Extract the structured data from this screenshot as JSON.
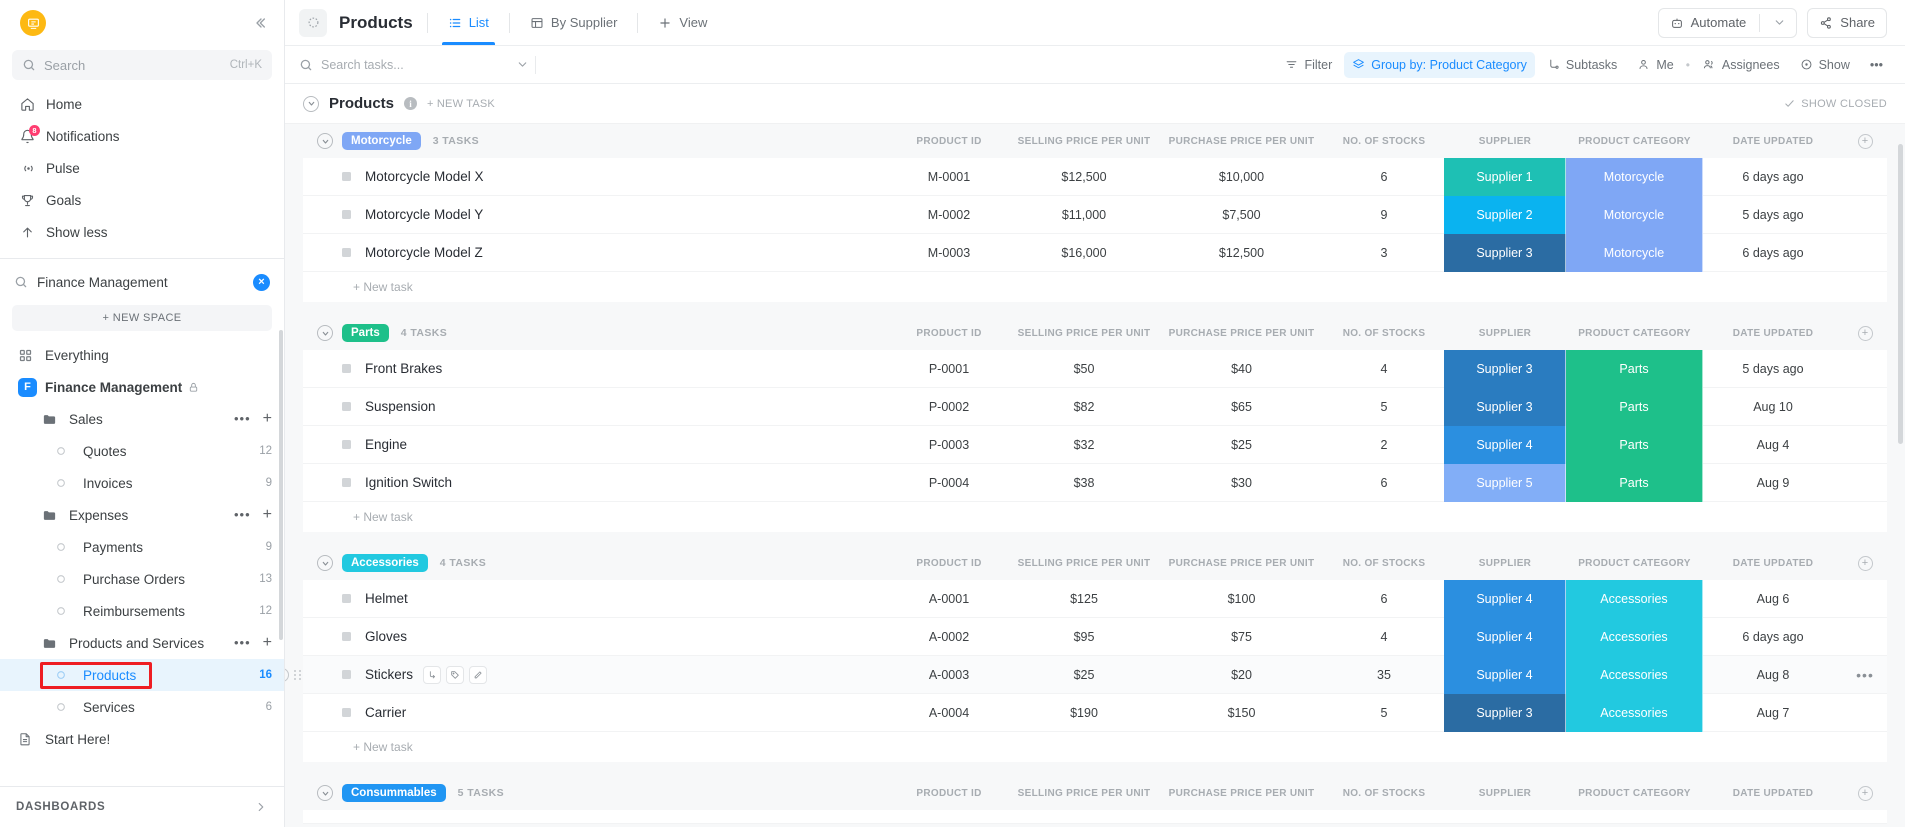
{
  "sidebar": {
    "logo_icon": "clickup-logo-icon",
    "collapse_icon": "collapse-sidebar-icon",
    "search": {
      "placeholder": "Search",
      "shortcut": "Ctrl+K",
      "icon": "search-icon"
    },
    "nav": [
      {
        "label": "Home",
        "icon": "home-icon",
        "badge": ""
      },
      {
        "label": "Notifications",
        "icon": "bell-icon",
        "badge": "8"
      },
      {
        "label": "Pulse",
        "icon": "pulse-icon",
        "badge": ""
      },
      {
        "label": "Goals",
        "icon": "trophy-icon",
        "badge": ""
      },
      {
        "label": "Show less",
        "icon": "arrow-up-icon",
        "badge": ""
      }
    ],
    "space_search": {
      "value": "Finance Management",
      "icon": "search-icon",
      "avatar": "F"
    },
    "new_space_label": "+ NEW SPACE",
    "tree": [
      {
        "label": "Everything",
        "level": 0,
        "icon": "grid-icon",
        "count": "",
        "selected": false,
        "bold": false,
        "dots": false,
        "lock": false
      },
      {
        "label": "Finance Management",
        "level": 0,
        "icon": "space-avatar",
        "avatar": "F",
        "count": "",
        "selected": false,
        "bold": true,
        "dots": false,
        "lock": true
      },
      {
        "label": "Sales",
        "level": 1,
        "icon": "folder-icon",
        "count": "",
        "selected": false,
        "bold": false,
        "dots": true,
        "lock": false
      },
      {
        "label": "Quotes",
        "level": 2,
        "icon": "list-dot-icon",
        "count": "12",
        "selected": false,
        "bold": false,
        "dots": false,
        "lock": false
      },
      {
        "label": "Invoices",
        "level": 2,
        "icon": "list-dot-icon",
        "count": "9",
        "selected": false,
        "bold": false,
        "dots": false,
        "lock": false
      },
      {
        "label": "Expenses",
        "level": 1,
        "icon": "folder-icon",
        "count": "",
        "selected": false,
        "bold": false,
        "dots": true,
        "lock": false
      },
      {
        "label": "Payments",
        "level": 2,
        "icon": "list-dot-icon",
        "count": "9",
        "selected": false,
        "bold": false,
        "dots": false,
        "lock": false
      },
      {
        "label": "Purchase Orders",
        "level": 2,
        "icon": "list-dot-icon",
        "count": "13",
        "selected": false,
        "bold": false,
        "dots": false,
        "lock": false
      },
      {
        "label": "Reimbursements",
        "level": 2,
        "icon": "list-dot-icon",
        "count": "12",
        "selected": false,
        "bold": false,
        "dots": false,
        "lock": false
      },
      {
        "label": "Products and Services",
        "level": 1,
        "icon": "folder-icon",
        "count": "",
        "selected": false,
        "bold": false,
        "dots": true,
        "lock": false
      },
      {
        "label": "Products",
        "level": 2,
        "icon": "list-dot-icon",
        "count": "16",
        "selected": true,
        "bold": false,
        "dots": false,
        "lock": false,
        "highlighted": true
      },
      {
        "label": "Services",
        "level": 2,
        "icon": "list-dot-icon",
        "count": "6",
        "selected": false,
        "bold": false,
        "dots": false,
        "lock": false
      },
      {
        "label": "Start Here!",
        "level": 0,
        "icon": "doc-icon",
        "count": "",
        "selected": false,
        "bold": false,
        "dots": false,
        "lock": false
      }
    ],
    "dashboards_label": "DASHBOARDS"
  },
  "topbar": {
    "view_icon": "list-view-avatar-icon",
    "title": "Products",
    "tabs": [
      {
        "label": "List",
        "icon": "list-icon",
        "active": true
      },
      {
        "label": "By Supplier",
        "icon": "table-icon",
        "active": false
      },
      {
        "label": "View",
        "icon": "plus-icon",
        "active": false
      }
    ],
    "automate_label": "Automate",
    "automate_icon": "robot-icon",
    "share_label": "Share",
    "share_icon": "share-icon"
  },
  "toolbar": {
    "search_placeholder": "Search tasks...",
    "search_icon": "search-icon",
    "buttons": [
      {
        "label": "Filter",
        "icon": "filter-icon",
        "active": false
      },
      {
        "label": "Group by: Product Category",
        "icon": "group-icon",
        "active": true
      },
      {
        "label": "Subtasks",
        "icon": "subtasks-icon",
        "active": false
      },
      {
        "label": "Me",
        "icon": "person-icon",
        "active": false
      },
      {
        "label": "Assignees",
        "icon": "people-icon",
        "active": false
      },
      {
        "label": "Show",
        "icon": "eye-icon",
        "active": false
      },
      {
        "label": "•••",
        "icon": "more-icon",
        "active": false
      }
    ]
  },
  "list_header": {
    "title": "Products",
    "info_icon": "info-icon",
    "new_task_label": "+ NEW TASK",
    "show_closed_label": "SHOW CLOSED",
    "show_closed_icon": "check-icon",
    "collapse_icon": "chevron-down-circle-icon"
  },
  "columns": [
    "PRODUCT ID",
    "SELLING PRICE PER UNIT",
    "PURCHASE PRICE PER UNIT",
    "NO. OF STOCKS",
    "SUPPLIER",
    "PRODUCT CATEGORY",
    "DATE UPDATED"
  ],
  "new_task_row_label": "+ New task",
  "colors": {
    "accent": "#1a8cff",
    "supplier_1": "#1ec0b4",
    "supplier_2": "#0ab3f0",
    "supplier_3": "#2b6ca3",
    "supplier_3_alt": "#2a7cc0",
    "supplier_4": "#2b8fe0",
    "supplier_5": "#82aef7",
    "cat_motorcycle": "#7fa7f5",
    "cat_parts": "#1ec08a",
    "cat_accessories": "#22c9e0",
    "chip_motorcycle": "#7fa7f5",
    "chip_parts": "#1ec08a",
    "chip_accessories": "#22c9e0",
    "chip_consummables": "#2196f3",
    "highlight_box": "#ee1d23"
  },
  "groups": [
    {
      "name": "Motorcycle",
      "chip_color": "#7fa7f5",
      "task_count": "3 TASKS",
      "rows": [
        {
          "name": "Motorcycle Model X",
          "product_id": "M-0001",
          "selling": "$12,500",
          "purchase": "$10,000",
          "stocks": "6",
          "supplier": "Supplier 1",
          "supplier_color": "#1ec0b4",
          "category": "Motorcycle",
          "category_color": "#7fa7f5",
          "date": "6 days ago"
        },
        {
          "name": "Motorcycle Model Y",
          "product_id": "M-0002",
          "selling": "$11,000",
          "purchase": "$7,500",
          "stocks": "9",
          "supplier": "Supplier 2",
          "supplier_color": "#0ab3f0",
          "category": "Motorcycle",
          "category_color": "#7fa7f5",
          "date": "5 days ago"
        },
        {
          "name": "Motorcycle Model Z",
          "product_id": "M-0003",
          "selling": "$16,000",
          "purchase": "$12,500",
          "stocks": "3",
          "supplier": "Supplier 3",
          "supplier_color": "#2b6ca3",
          "category": "Motorcycle",
          "category_color": "#7fa7f5",
          "date": "6 days ago"
        }
      ]
    },
    {
      "name": "Parts",
      "chip_color": "#1ec08a",
      "task_count": "4 TASKS",
      "rows": [
        {
          "name": "Front Brakes",
          "product_id": "P-0001",
          "selling": "$50",
          "purchase": "$40",
          "stocks": "4",
          "supplier": "Supplier 3",
          "supplier_color": "#2a7cc0",
          "category": "Parts",
          "category_color": "#1ec08a",
          "date": "5 days ago"
        },
        {
          "name": "Suspension",
          "product_id": "P-0002",
          "selling": "$82",
          "purchase": "$65",
          "stocks": "5",
          "supplier": "Supplier 3",
          "supplier_color": "#2a7cc0",
          "category": "Parts",
          "category_color": "#1ec08a",
          "date": "Aug 10"
        },
        {
          "name": "Engine",
          "product_id": "P-0003",
          "selling": "$32",
          "purchase": "$25",
          "stocks": "2",
          "supplier": "Supplier 4",
          "supplier_color": "#2b8fe0",
          "category": "Parts",
          "category_color": "#1ec08a",
          "date": "Aug 4"
        },
        {
          "name": "Ignition Switch",
          "product_id": "P-0004",
          "selling": "$38",
          "purchase": "$30",
          "stocks": "6",
          "supplier": "Supplier 5",
          "supplier_color": "#82aef7",
          "category": "Parts",
          "category_color": "#1ec08a",
          "date": "Aug 9"
        }
      ]
    },
    {
      "name": "Accessories",
      "chip_color": "#22c9e0",
      "task_count": "4 TASKS",
      "rows": [
        {
          "name": "Helmet",
          "product_id": "A-0001",
          "selling": "$125",
          "purchase": "$100",
          "stocks": "6",
          "supplier": "Supplier 4",
          "supplier_color": "#2b8fe0",
          "category": "Accessories",
          "category_color": "#22c9e0",
          "date": "Aug 6"
        },
        {
          "name": "Gloves",
          "product_id": "A-0002",
          "selling": "$95",
          "purchase": "$75",
          "stocks": "4",
          "supplier": "Supplier 4",
          "supplier_color": "#2b8fe0",
          "category": "Accessories",
          "category_color": "#22c9e0",
          "date": "6 days ago"
        },
        {
          "name": "Stickers",
          "product_id": "A-0003",
          "selling": "$25",
          "purchase": "$20",
          "stocks": "35",
          "supplier": "Supplier 4",
          "supplier_color": "#2b8fe0",
          "category": "Accessories",
          "category_color": "#22c9e0",
          "date": "Aug 8",
          "hovered": true
        },
        {
          "name": "Carrier",
          "product_id": "A-0004",
          "selling": "$190",
          "purchase": "$150",
          "stocks": "5",
          "supplier": "Supplier 3",
          "supplier_color": "#2b6ca3",
          "category": "Accessories",
          "category_color": "#22c9e0",
          "date": "Aug 7"
        }
      ]
    },
    {
      "name": "Consummables",
      "chip_color": "#2196f3",
      "task_count": "5 TASKS",
      "rows": []
    }
  ]
}
